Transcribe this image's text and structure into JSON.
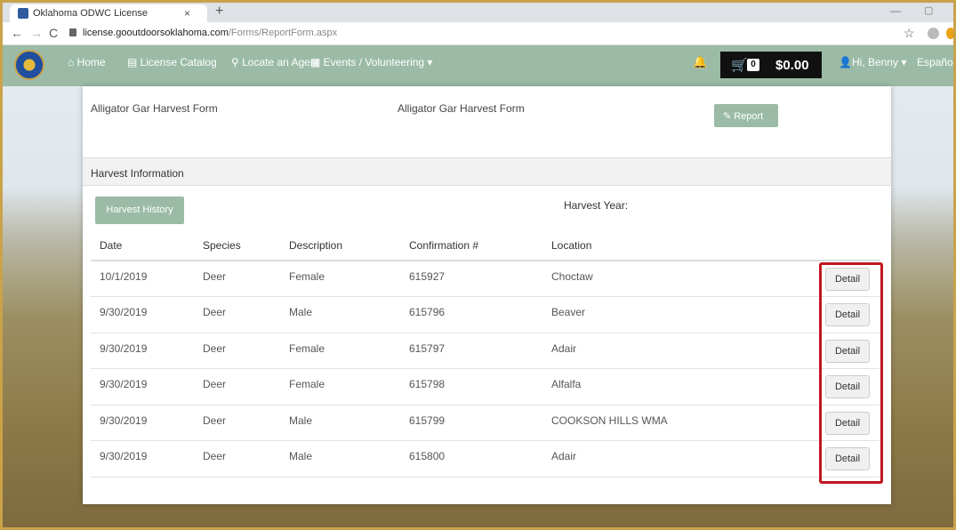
{
  "browser": {
    "tab_title": "Oklahoma ODWC License",
    "tab_close": "×",
    "new_tab": "+",
    "url_host": "license.gooutdoorsoklahoma.com",
    "url_path": "/Forms/ReportForm.aspx"
  },
  "nav": {
    "home": "Home",
    "catalog": "License Catalog",
    "agent": "Locate an Agent",
    "events": "Events / Volunteering",
    "cart_count": "0",
    "cart_total": "$0.00",
    "user": "Hi, Benny",
    "language": "Español"
  },
  "panel": {
    "top_left": "Alligator Gar Harvest Form",
    "top_mid": "Alligator Gar Harvest Form",
    "report_label": "Report",
    "section_title": "Harvest Information",
    "history_button": "Harvest History",
    "harvest_year_label": "Harvest Year:"
  },
  "table": {
    "headers": [
      "Date",
      "Species",
      "Description",
      "Confirmation #",
      "Location"
    ],
    "detail_label": "Detail",
    "rows": [
      {
        "date": "10/1/2019",
        "species": "Deer",
        "description": "Female",
        "confirmation": "615927",
        "location": "Choctaw"
      },
      {
        "date": "9/30/2019",
        "species": "Deer",
        "description": "Male",
        "confirmation": "615796",
        "location": "Beaver"
      },
      {
        "date": "9/30/2019",
        "species": "Deer",
        "description": "Female",
        "confirmation": "615797",
        "location": "Adair"
      },
      {
        "date": "9/30/2019",
        "species": "Deer",
        "description": "Female",
        "confirmation": "615798",
        "location": "Alfalfa"
      },
      {
        "date": "9/30/2019",
        "species": "Deer",
        "description": "Male",
        "confirmation": "615799",
        "location": "COOKSON HILLS WMA"
      },
      {
        "date": "9/30/2019",
        "species": "Deer",
        "description": "Male",
        "confirmation": "615800",
        "location": "Adair"
      }
    ]
  },
  "colors": {
    "nav_green": "#9bbba7",
    "highlight_red": "#c0161f",
    "cart_black": "#111111"
  }
}
